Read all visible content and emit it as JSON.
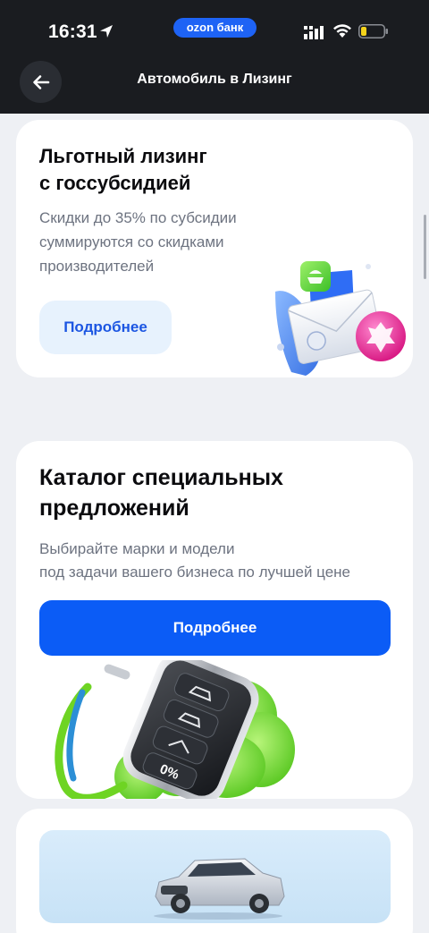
{
  "status_bar": {
    "time": "16:31",
    "brand_pill": "ozon банк"
  },
  "nav": {
    "title": "Автомобиль в Лизинг",
    "back_icon": "arrow-left-icon"
  },
  "cards": [
    {
      "title_line1": "Льготный лизинг",
      "title_line2": "с госсубсидией",
      "desc_line1": "Скидки до 35% по субсидии",
      "desc_line2": "суммируются со скидками",
      "desc_line3": "производителей",
      "button_label": "Подробнее",
      "illustration": "envelope-with-coat-of-arms-icon"
    },
    {
      "title_line1": "Каталог специальных",
      "title_line2": "предложений",
      "desc_line1": "Выбирайте марки и модели",
      "desc_line2": "под задачи вашего бизнеса по лучшей цене",
      "button_label": "Подробнее",
      "key_badge": "0%",
      "illustration": "car-key-fob-icon"
    },
    {
      "illustration": "suv-car-icon"
    }
  ],
  "colors": {
    "primary": "#0b5cf6",
    "topbar": "#1a1c20",
    "light_button": "#e7f2fd",
    "brand_pill": "#1e63f5"
  }
}
